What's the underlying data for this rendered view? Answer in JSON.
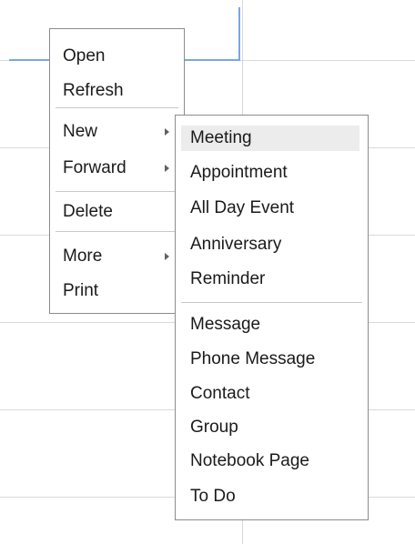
{
  "context_menu": {
    "items": [
      {
        "label": "Open"
      },
      {
        "label": "Refresh"
      },
      {
        "label": "New"
      },
      {
        "label": "Forward"
      },
      {
        "label": "Delete"
      },
      {
        "label": "More"
      },
      {
        "label": "Print"
      }
    ]
  },
  "submenu_new": {
    "items": [
      {
        "label": "Meeting"
      },
      {
        "label": "Appointment"
      },
      {
        "label": "All Day Event"
      },
      {
        "label": "Anniversary"
      },
      {
        "label": "Reminder"
      },
      {
        "label": "Message"
      },
      {
        "label": "Phone Message"
      },
      {
        "label": "Contact"
      },
      {
        "label": "Group"
      },
      {
        "label": "Notebook Page"
      },
      {
        "label": "To Do"
      }
    ],
    "highlighted_item": "Meeting"
  },
  "colors": {
    "menu_border": "#8c8c8c",
    "highlight": "#ececec",
    "selection_blue": "#7aa6de",
    "grid_line": "#d9d9d9"
  }
}
